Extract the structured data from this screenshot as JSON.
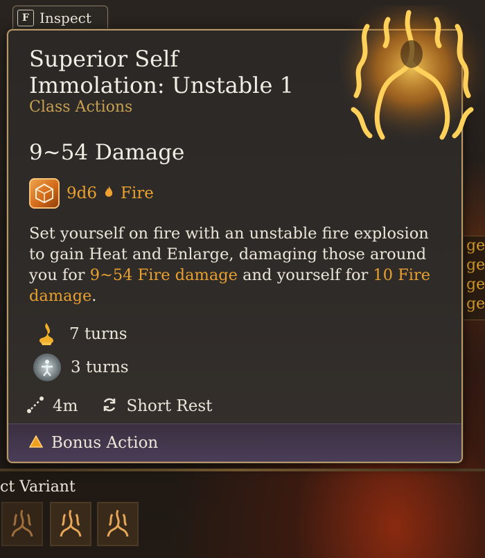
{
  "inspect": {
    "key": "F",
    "label": "Inspect"
  },
  "tooltip": {
    "title_line1": "Superior Self",
    "title_line2": "Immolation: Unstable 1",
    "category": "Class Actions",
    "damage": "9~54 Damage",
    "dice": {
      "roll": "9d6",
      "type": "Fire"
    },
    "description": {
      "part1": "Set yourself on fire with an unstable fire explosion to gain Heat and Enlarge, damaging those around you for ",
      "highlight1": "9~54 Fire damage",
      "part2": " and yourself for ",
      "highlight2": "10 Fire damage",
      "part3": "."
    },
    "conditions": [
      {
        "icon": "heat-icon",
        "text": "7 turns"
      },
      {
        "icon": "enlarge-icon",
        "text": "3 turns"
      }
    ],
    "range": "4m",
    "recharge": "Short Rest",
    "action_type": "Bonus Action"
  },
  "background": {
    "right_snippet": [
      "ge",
      "ge",
      "ge",
      "ge"
    ],
    "select_variant_label": "ct Variant"
  },
  "colors": {
    "accent_gold": "#c8a252",
    "fire_orange": "#e8a030",
    "panel": "#2b2826",
    "action_bar": "#4a3d58"
  }
}
